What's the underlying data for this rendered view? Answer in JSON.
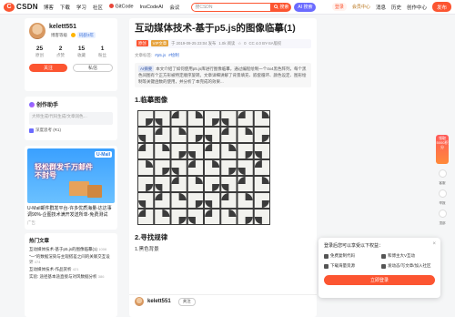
{
  "nav": {
    "logo_text": "CSDN",
    "items": [
      "博客",
      "下载",
      "学习",
      "社区",
      "GitCode",
      "InsCodeAI",
      "会议"
    ],
    "search_placeholder": "搜CSDN",
    "search_btn": "搜索",
    "ai_btn": "AI 搜索",
    "login": "登录",
    "vip": "会员中心",
    "messages": "消息",
    "history": "历史",
    "creator": "创作中心",
    "publish": "发布"
  },
  "profile": {
    "username": "kelett551",
    "badge_blog": "博客等级",
    "badge_level": "码龄3年",
    "stats": [
      {
        "num": "25",
        "label": "原创"
      },
      {
        "num": "2",
        "label": "点赞"
      },
      {
        "num": "15",
        "label": "收藏"
      },
      {
        "num": "1",
        "label": "粉丝"
      }
    ],
    "follow": "关注",
    "message": "私信"
  },
  "assistant": {
    "title": "创作助手",
    "placeholder": "大师生成/代码生成/文章润色…",
    "footer": "深度思考 (R1)"
  },
  "ad": {
    "brand": "U-Mail",
    "headline": "轻松群发千万邮件\n不封号",
    "text": "U-Mail邮件群发平台-许多优质海量-达达事调90%-企图技术满开发送所单-免费测试",
    "sub": "广告"
  },
  "hot": {
    "title": "热门文章",
    "items": [
      {
        "text": "互动媒体技术-基于p5.js的图像临摹(1)",
        "views": "1006"
      },
      {
        "text": "\"一\"的数据渲染与主观搭差之间的关联交互设计",
        "views": "474"
      },
      {
        "text": "互动媒体技术-作品赏析",
        "views": "421"
      },
      {
        "text": "实验: 途径基本途直接与对风数据分析",
        "views": "386"
      }
    ]
  },
  "article": {
    "title": "互动媒体技术-基于p5.js的图像临摹(1)",
    "tag_orig": "原创",
    "tag_vip": "VIP文章",
    "meta_date": "于 2019-09-25 23:04 发布",
    "meta_views": "1.0k 阅读",
    "meta_likes": "0",
    "meta_license": "CC 4.0 BY-SA版权",
    "tags_label": "文章标签:",
    "tags": [
      "#p5.js",
      "#绘制"
    ],
    "summary_badge": "AI摘要",
    "summary": "本文介绍了如何使用p5.js库进行图像临摹，通过编程绘制一个4x4黑色阵列，每个黑色间图有个正方形被特定顺序旋转。文章详细讲解了背景填充、嵌套循环、颜色设定、图形绘制等关键函数的使用，并分析了本完成的效果...",
    "h1": "1.临摹图像",
    "h2": "2.寻找规律",
    "h3": "1.黑色背景"
  },
  "author_bar": {
    "name": "kelett551",
    "follow": "关注"
  },
  "float": {
    "badge": "领取5000积分",
    "tools": [
      "客服",
      "举报",
      "顶部"
    ]
  },
  "popup": {
    "title": "登录后您可以享受以下权益：",
    "items": [
      "免费复制代码",
      "和博主大V互动",
      "下载海量资源",
      "发动态/写文章/加入社区"
    ],
    "button": "立即登录",
    "close": "×"
  }
}
